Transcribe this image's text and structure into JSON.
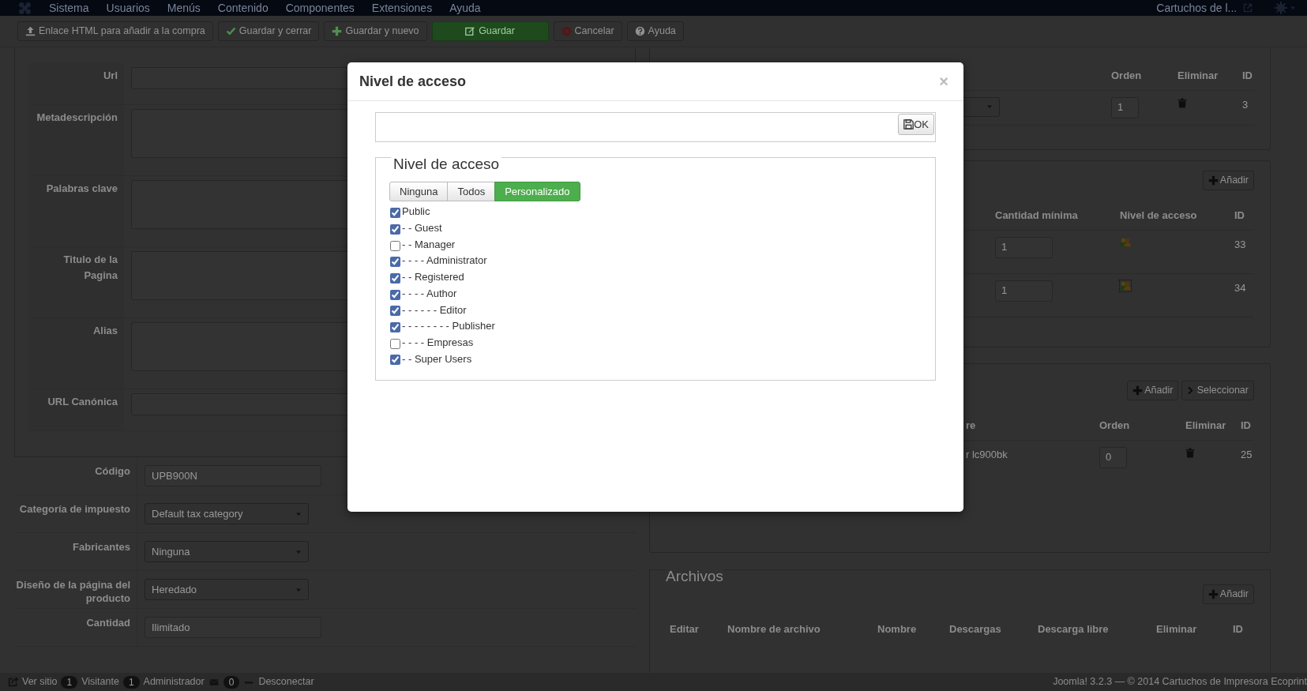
{
  "navbar": {
    "menu": [
      "Sistema",
      "Usuarios",
      "Menús",
      "Contenido",
      "Componentes",
      "Extensiones",
      "Ayuda"
    ],
    "site_link": "Cartuchos de l..."
  },
  "toolbar": [
    {
      "label": "Enlace HTML para añadir a la compra",
      "kind": "default"
    },
    {
      "label": "Guardar y cerrar",
      "kind": "default"
    },
    {
      "label": "Guardar y nuevo",
      "kind": "default"
    },
    {
      "label": "Guardar",
      "kind": "success"
    },
    {
      "label": "Cancelar",
      "kind": "default"
    },
    {
      "label": "Ayuda",
      "kind": "default"
    }
  ],
  "seo_fields": [
    {
      "label": "Url",
      "kind": "input"
    },
    {
      "label": "Metadescripción",
      "kind": "textarea"
    },
    {
      "label": "Palabras clave",
      "kind": "textarea"
    },
    {
      "label": "Titulo de la Pagina",
      "kind": "textarea"
    },
    {
      "label": "Alias",
      "kind": "textarea"
    },
    {
      "label": "URL Canónica",
      "kind": "input"
    }
  ],
  "product_fields": [
    {
      "label": "Código",
      "kind": "input",
      "value": "UPB900N"
    },
    {
      "label": "Categoría de impuesto",
      "kind": "select",
      "value": "Default tax category"
    },
    {
      "label": "Fabricantes",
      "kind": "select",
      "value": "Ninguna"
    },
    {
      "label": "Diseño de la página del producto",
      "kind": "select",
      "value": "Heredado"
    },
    {
      "label": "Cantidad",
      "kind": "input",
      "value": "Ilimitado"
    }
  ],
  "related_panel": {
    "columns": [
      "Orden",
      "Eliminar",
      "ID"
    ],
    "rows": [
      {
        "order": "1",
        "id": "3"
      }
    ]
  },
  "prices_panel": {
    "add_button": "Añadir",
    "columns": [
      "Cantidad mínima",
      "Nivel de acceso",
      "ID"
    ],
    "rows": [
      {
        "min_qty": "1",
        "id": "33",
        "focused": false
      },
      {
        "min_qty": "1",
        "id": "34",
        "focused": true
      }
    ]
  },
  "accessories_panel": {
    "buttons": [
      "Añadir",
      "Seleccionar"
    ],
    "columns": [
      "re",
      "Orden",
      "Eliminar",
      "ID"
    ],
    "rows": [
      {
        "name": "r lc900bk",
        "order": "0",
        "id": "25"
      }
    ]
  },
  "files_panel": {
    "legend": "Archivos",
    "add_button": "Añadir",
    "columns": [
      "Editar",
      "Nombre de archivo",
      "Nombre",
      "Descargas",
      "Descarga libre",
      "Eliminar",
      "ID"
    ]
  },
  "status_bar": {
    "view_site": "Ver sitio",
    "visitors": "1",
    "visitors_label": "Visitante",
    "admins": "1",
    "admins_label": "Administrador",
    "messages": "0",
    "logout": "Desconectar",
    "copyright": "Joomla! 3.2.3 — © 2014 Cartuchos de Impresora Ecoprint"
  },
  "modal": {
    "title": "Nivel de acceso",
    "close": "×",
    "ok_button": "OK",
    "legend": "Nivel de acceso",
    "modes": [
      {
        "label": "Ninguna",
        "selected": false
      },
      {
        "label": "Todos",
        "selected": false
      },
      {
        "label": "Personalizado",
        "selected": true
      }
    ],
    "groups": [
      {
        "label": "Public",
        "checked": true
      },
      {
        "label": "- - Guest",
        "checked": true
      },
      {
        "label": "- - Manager",
        "checked": false
      },
      {
        "label": "- - - - Administrator",
        "checked": true
      },
      {
        "label": "- - Registered",
        "checked": true
      },
      {
        "label": "- - - - Author",
        "checked": true
      },
      {
        "label": "- - - - - - Editor",
        "checked": true
      },
      {
        "label": "- - - - - - - - Publisher",
        "checked": true
      },
      {
        "label": "- - - - Empresas",
        "checked": false
      },
      {
        "label": "- - Super Users",
        "checked": true
      }
    ]
  }
}
